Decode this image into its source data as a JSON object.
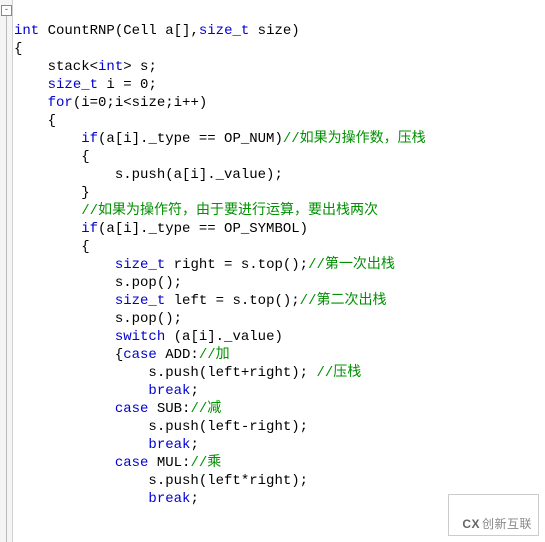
{
  "fold_glyph": "-",
  "code": {
    "l1": {
      "kw1": "int",
      "fn": " CountRNP(Cell a[],",
      "kw2": "size_t",
      "rest": " size)"
    },
    "l2": "{",
    "l3": {
      "pre": "    stack<",
      "kw": "int",
      "post": "> s;"
    },
    "l4": {
      "pre": "    ",
      "kw": "size_t",
      "post": " i = 0;"
    },
    "l5": {
      "pre": "    ",
      "kw": "for",
      "post": "(i=0;i<size;i++)"
    },
    "l6": "    {",
    "l7": {
      "pre": "        ",
      "kw": "if",
      "post": "(a[i]._type == OP_NUM)",
      "cmt": "//如果为操作数，压栈"
    },
    "l8": "        {",
    "l9": "            s.push(a[i]._value);",
    "l10": "        }",
    "l11": {
      "pre": "        ",
      "cmt": "//如果为操作符，由于要进行运算，要出栈两次"
    },
    "l12": {
      "pre": "        ",
      "kw": "if",
      "post": "(a[i]._type == OP_SYMBOL)"
    },
    "l13": "        {",
    "l14": {
      "pre": "            ",
      "kw": "size_t",
      "post": " right = s.top();",
      "cmt": "//第一次出栈"
    },
    "l15": "            s.pop();",
    "l16": {
      "pre": "            ",
      "kw": "size_t",
      "post": " left = s.top();",
      "cmt": "//第二次出栈"
    },
    "l17": "            s.pop();",
    "l18": {
      "pre": "            ",
      "kw": "switch",
      "post": " (a[i]._value)"
    },
    "l19": {
      "pre": "            {",
      "kw": "case",
      "post": " ADD:",
      "cmt": "//加"
    },
    "l20": {
      "pre": "                s.push(left+right); ",
      "cmt": "//压栈"
    },
    "l21": {
      "pre": "                ",
      "kw": "break",
      "post": ";"
    },
    "l22": {
      "pre": "            ",
      "kw": "case",
      "post": " SUB:",
      "cmt": "//减"
    },
    "l23": "                s.push(left-right);",
    "l24": {
      "pre": "                ",
      "kw": "break",
      "post": ";"
    },
    "l25": {
      "pre": "            ",
      "kw": "case",
      "post": " MUL:",
      "cmt": "//乘"
    },
    "l26": "                s.push(left*right);",
    "l27": {
      "pre": "                ",
      "kw": "break",
      "post": ";"
    }
  },
  "watermark": {
    "logo": "CX",
    "text": "创新互联"
  }
}
